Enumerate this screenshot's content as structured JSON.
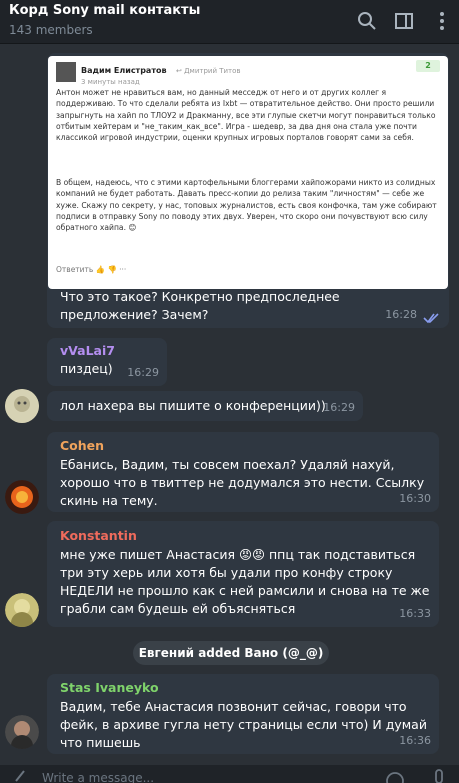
{
  "header": {
    "title": "Корд Sony mail контакты",
    "members": "143 members"
  },
  "screenshot_post": {
    "author": "Вадим Елистратов",
    "reply_to": "↩ Дмитрий Титов",
    "time_ago": "3 минуты назад",
    "score": "2",
    "paragraph1": "Антон может не нравиться вам, но данный месседж от него и от других коллег я поддерживаю. То что сделали ребята из Ixbt — отвратительное действо. Они просто решили запрыгнуть на хайп по ТЛОУ2 и Дракманну, все эти глупые скетчи могут понравиться только отбитым хейтерам и \"не_таким_как_все\". Игра - шедевр, за два дня она стала уже почти классикой игровой индустрии, оценки крупных игровых порталов говорят сами за себя.",
    "paragraph2": "В общем, надеюсь, что с этими картофельными блоггерами хайпожорами никто из солидных компаний не будет работать. Давать пресс-копии до релиза таким \"личностям\" — себе же хуже. Скажу по секрету, у нас, топовых журналистов, есть своя конфочка, там уже собирают подписи в отправку Sony по поводу этих двух. Уверен, что скоро они почувствуют всю силу обратного хайпа. 😊",
    "footer": "Ответить  👍  👎  ···"
  },
  "messages": [
    {
      "text": "Что это такое? Конкретно предпоследнее предложение? Зачем?",
      "time": "16:28"
    },
    {
      "sender": "vVaLai7",
      "sender_color": "#b48ef0",
      "text": "пиздец)",
      "time": "16:29"
    },
    {
      "text": "лол нахера вы пишите о конференции))",
      "time": "16:29"
    },
    {
      "sender": "Cohen",
      "sender_color": "#f0a35c",
      "text": "Ебанись, Вадим, ты совсем поехал? Удаляй нахуй, хорошо что в твиттер не додумался это нести. Ссылку скинь на тему.",
      "time": "16:30"
    },
    {
      "sender": "Konstantin",
      "sender_color": "#ef6b5c",
      "text": "мне уже пишет Анастасия 😡😡 ппц так подставиться три эту херь или хотя бы удали про конфу строку НЕДЕЛИ не прошло как с ней рамсили и снова на те же грабли сам будешь ей объясняться",
      "time": "16:33"
    },
    {
      "sender": "Stas Ivaneyko",
      "sender_color": "#7fd36b",
      "text": "Вадим, тебе Анастасия позвонит сейчас, говори что фейк, в архиве гугла нету страницы если что) И думай что пишешь",
      "time": "16:36"
    }
  ],
  "system_message": "Евгений added Вано (@_@)",
  "composer": {
    "placeholder": "Write a message..."
  },
  "colors": {
    "background": "#2b3036",
    "bubble": "#2f3741",
    "header": "#1f2328",
    "read_check": "#8a9ef0"
  }
}
